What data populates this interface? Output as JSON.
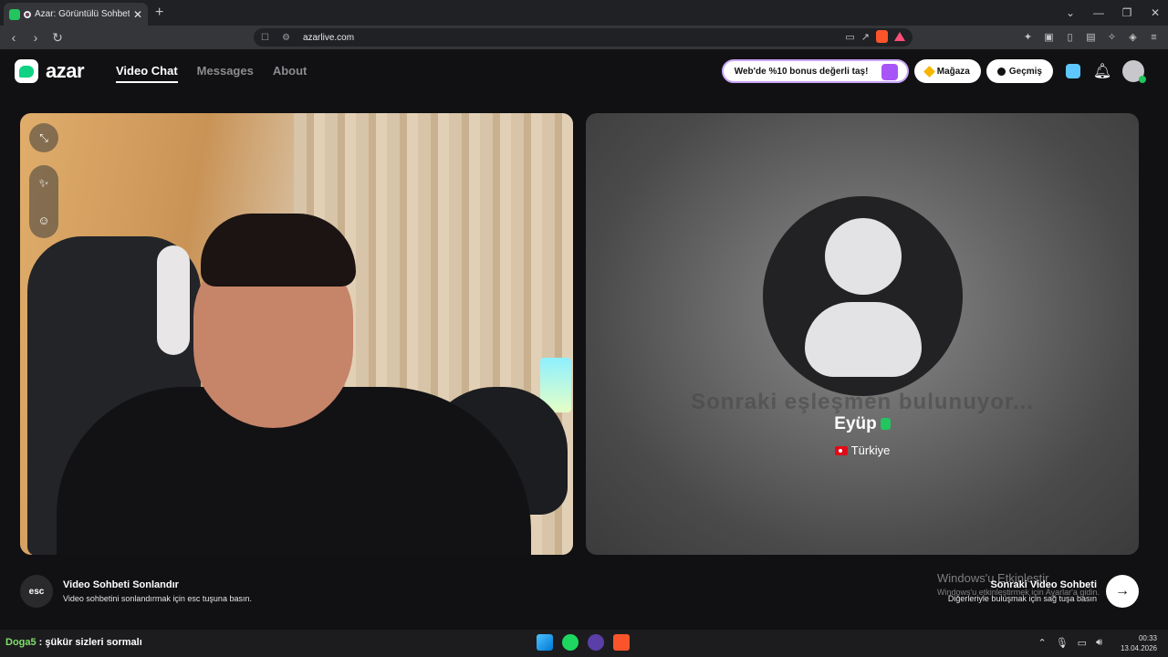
{
  "browser": {
    "tab_title": "Azar: Görüntülü Sohbet & Yeni",
    "new_tab": "+",
    "url": "azarlive.com",
    "window_controls": {
      "chevron": "⌄",
      "minimize": "—",
      "restore": "❐",
      "close": "✕"
    }
  },
  "app": {
    "logo_text": "azar",
    "nav": [
      {
        "label": "Video Chat",
        "active": true
      },
      {
        "label": "Messages",
        "active": false
      },
      {
        "label": "About",
        "active": false
      }
    ],
    "promo_text": "Web'de %10 bonus değerli taş!",
    "store_label": "Mağaza",
    "history_label": "Geçmiş"
  },
  "partner": {
    "overlay_text": "Sonraki eşleşmen bulunuyor...",
    "name": "Eyüp",
    "country": "Türkiye"
  },
  "footer": {
    "esc_key": "esc",
    "end_title": "Video Sohbeti Sonlandır",
    "end_desc": "Video sohbetini sonlandırmak için esc tuşuna basın.",
    "next_title": "Sonraki Video Sohbeti",
    "next_desc": "Diğerleriyle buluşmak için sağ tuşa basın",
    "next_arrow": "→"
  },
  "windows_watermark": {
    "line1": "Windows'u Etkinleştir",
    "line2": "Windows'u etkinleştirmek için Ayarlar'a gidin."
  },
  "taskbar": {
    "chat_user": "Doga5",
    "chat_message": " : şükür sizleri sormalı",
    "time": "00:33",
    "date": "13.04.2026"
  },
  "colors": {
    "accent": "#10d283",
    "promo_border": "#c9a6f8",
    "verified": "#22c55e"
  }
}
